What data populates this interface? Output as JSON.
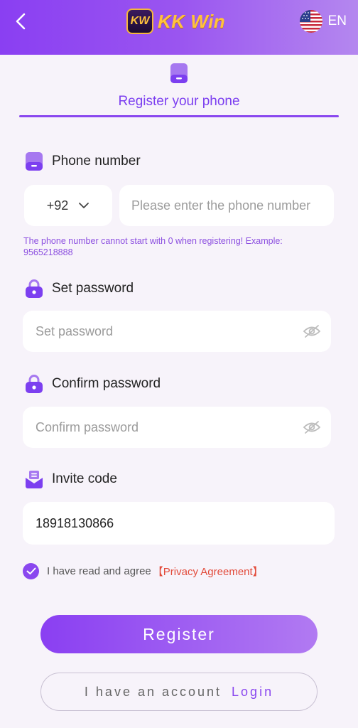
{
  "header": {
    "logo_badge": "KW",
    "logo_text": "KK Win",
    "language": "EN"
  },
  "tab": {
    "label": "Register your phone"
  },
  "phone": {
    "label": "Phone number",
    "country_code": "+92",
    "placeholder": "Please enter the phone number",
    "hint": "The phone number cannot start with 0 when registering! Example: 9565218888"
  },
  "password": {
    "label": "Set password",
    "placeholder": "Set password"
  },
  "confirm": {
    "label": "Confirm password",
    "placeholder": "Confirm password"
  },
  "invite": {
    "label": "Invite code",
    "value": "18918130866"
  },
  "agreement": {
    "text": "I have read and agree",
    "link": "【Privacy Agreement】",
    "checked": true
  },
  "buttons": {
    "register": "Register",
    "have_account": "I have an account",
    "login": "Login"
  },
  "colors": {
    "accent": "#8a47ef",
    "link_red": "#e24a3a",
    "background": "#f7f3fa"
  },
  "icons": [
    "back-arrow-icon",
    "us-flag-icon",
    "phone-icon",
    "lock-icon",
    "eye-off-icon",
    "invite-icon",
    "checkmark-icon",
    "chevron-down-icon"
  ]
}
